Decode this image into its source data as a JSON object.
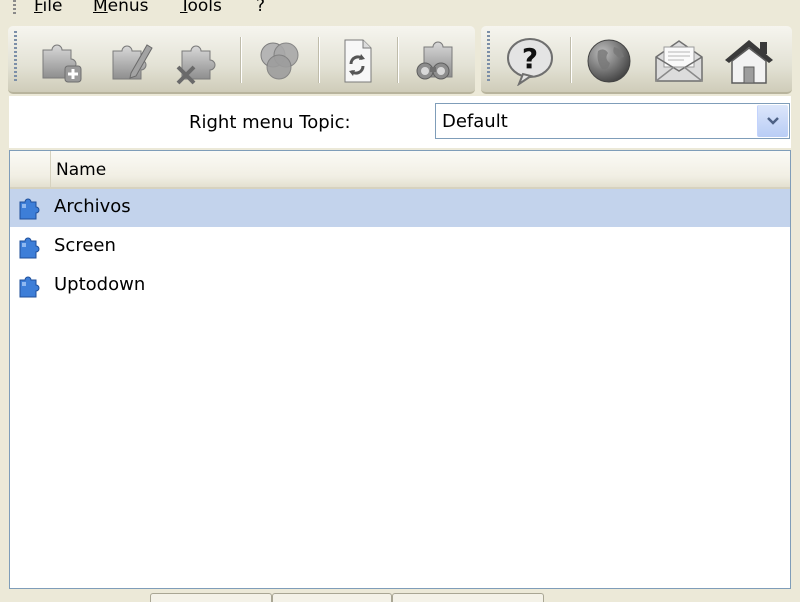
{
  "menu": {
    "items": [
      "File",
      "Menus",
      "Tools",
      "?"
    ]
  },
  "toolbar": {
    "buttons": [
      {
        "icon": "puzzle-add-icon"
      },
      {
        "icon": "puzzle-edit-icon"
      },
      {
        "icon": "puzzle-delete-icon"
      },
      {
        "icon": "circles-icon"
      },
      {
        "icon": "refresh-document-icon"
      },
      {
        "icon": "puzzle-binoculars-icon"
      },
      {
        "icon": "help-question-icon"
      },
      {
        "icon": "globe-icon"
      },
      {
        "icon": "mail-envelope-icon"
      },
      {
        "icon": "home-icon"
      }
    ]
  },
  "topic": {
    "label": "Right menu Topic:",
    "value": "Default"
  },
  "list": {
    "column_header": "Name",
    "rows": [
      {
        "label": "Archivos",
        "selected": true
      },
      {
        "label": "Screen",
        "selected": false
      },
      {
        "label": "Uptodown",
        "selected": false
      }
    ]
  },
  "colors": {
    "selection": "#c3d3ec",
    "window_bg": "#ece9d8",
    "puzzle_blue": "#3d7ed8"
  }
}
